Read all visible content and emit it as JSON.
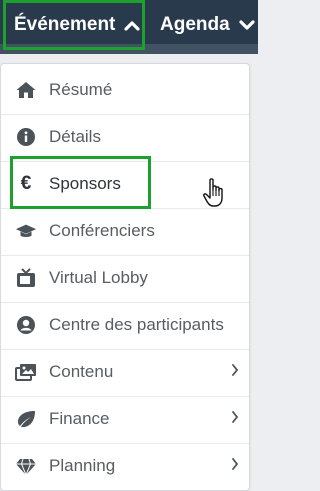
{
  "header": {
    "tabs": [
      {
        "label": "Événement",
        "state": "open"
      },
      {
        "label": "Agenda",
        "state": "closed"
      }
    ]
  },
  "menu": {
    "items": [
      {
        "label": "Résumé",
        "icon": "home-icon"
      },
      {
        "label": "Détails",
        "icon": "info-circle-icon"
      },
      {
        "label": "Sponsors",
        "icon": "euro-icon",
        "icon_glyph": "€",
        "highlighted": true
      },
      {
        "label": "Conférenciers",
        "icon": "graduation-cap-icon"
      },
      {
        "label": "Virtual Lobby",
        "icon": "tv-icon"
      },
      {
        "label": "Centre des participants",
        "icon": "user-circle-icon"
      },
      {
        "label": "Contenu",
        "icon": "images-icon",
        "has_submenu": true
      },
      {
        "label": "Finance",
        "icon": "leaf-icon",
        "has_submenu": true
      },
      {
        "label": "Planning",
        "icon": "diamond-icon",
        "has_submenu": true
      }
    ]
  },
  "colors": {
    "nav_bg": "#2a3a4d",
    "highlight": "#1ea02c",
    "menu_text": "#565d63",
    "icon": "#4b5258"
  }
}
